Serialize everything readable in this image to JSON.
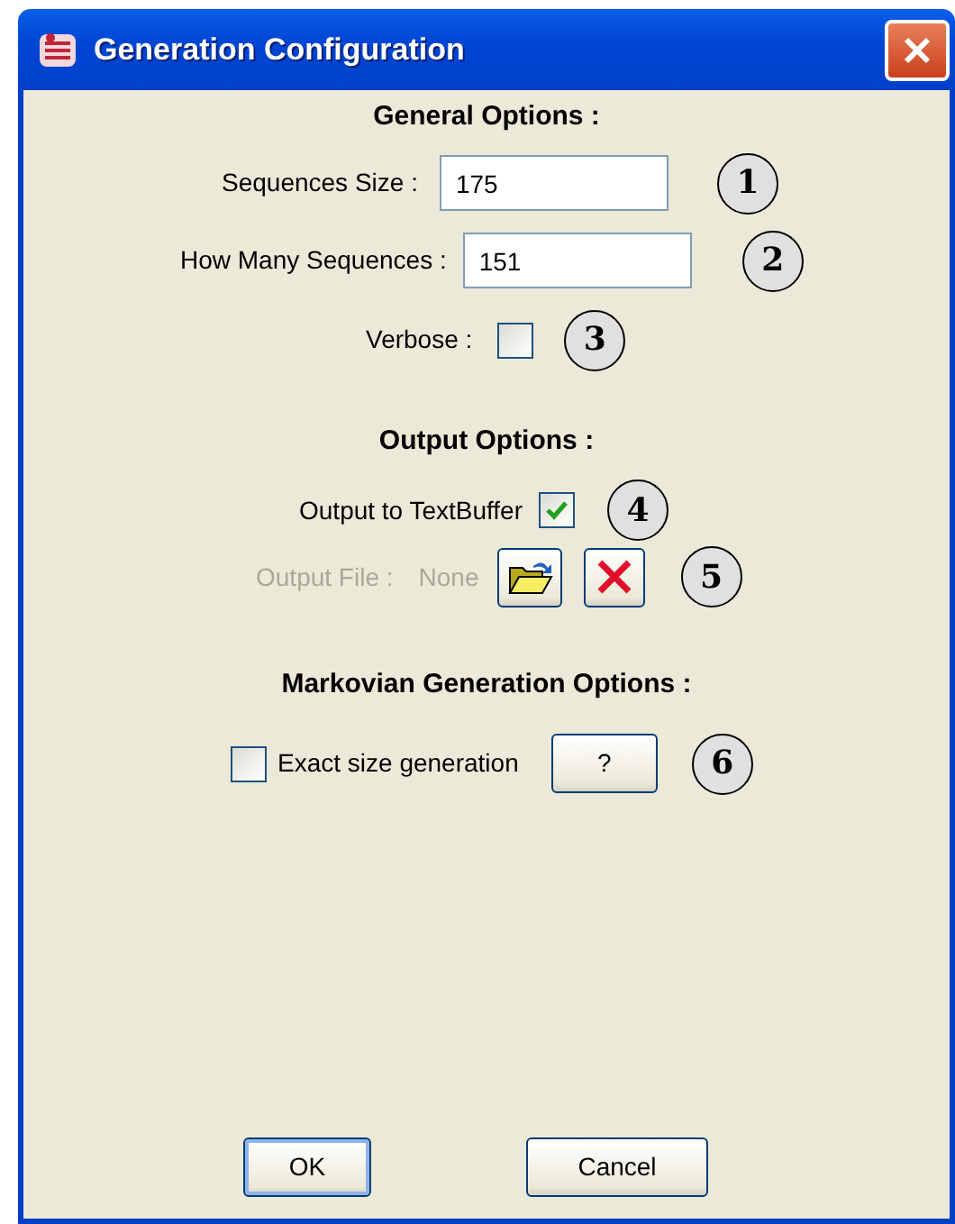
{
  "window": {
    "title": "Generation Configuration"
  },
  "general": {
    "heading": "General Options :",
    "fields": [
      {
        "label": "Sequences Size :",
        "value": "175",
        "marker": "1"
      },
      {
        "label": "How Many Sequences :",
        "value": "151",
        "marker": "2"
      }
    ],
    "verbose": {
      "label": "Verbose :",
      "checked": false,
      "marker": "3"
    }
  },
  "output": {
    "heading": "Output Options :",
    "text_buffer": {
      "label": "Output to TextBuffer",
      "checked": true,
      "marker": "4"
    },
    "file": {
      "label": "Output File :",
      "value": "None",
      "disabled": true,
      "marker": "5"
    }
  },
  "markovian": {
    "heading": "Markovian Generation Options :",
    "exact_size": {
      "label": "Exact size generation",
      "checked": false,
      "help": "?",
      "marker": "6"
    }
  },
  "buttons": [
    {
      "label": "OK",
      "default": true
    },
    {
      "label": "Cancel",
      "default": false
    }
  ]
}
